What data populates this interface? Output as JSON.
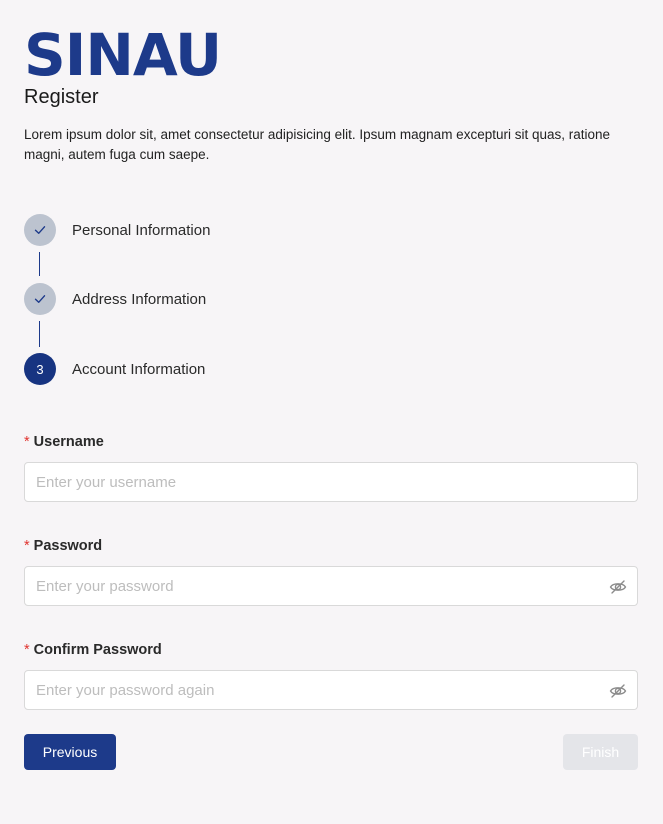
{
  "brand": {
    "logo_text": "SINAU"
  },
  "header": {
    "title": "Register",
    "description": "Lorem ipsum dolor sit, amet consectetur adipisicing elit. Ipsum magnam excepturi sit quas, ratione magni, autem fuga cum saepe."
  },
  "steps": [
    {
      "label": "Personal Information",
      "status": "completed",
      "icon": "check-icon"
    },
    {
      "label": "Address Information",
      "status": "completed",
      "icon": "check-icon"
    },
    {
      "label": "Account Information",
      "status": "active",
      "number": "3"
    }
  ],
  "form": {
    "required_marker": "*",
    "username": {
      "label": "Username",
      "placeholder": "Enter your username",
      "value": ""
    },
    "password": {
      "label": "Password",
      "placeholder": "Enter your password",
      "value": "",
      "toggle_icon": "eye-slash-icon"
    },
    "confirm_password": {
      "label": "Confirm Password",
      "placeholder": "Enter your password again",
      "value": "",
      "toggle_icon": "eye-slash-icon"
    }
  },
  "actions": {
    "previous_label": "Previous",
    "finish_label": "Finish",
    "finish_disabled": true
  },
  "colors": {
    "brand": "#1d3a8a",
    "step_done": "#bcc3cf",
    "step_active": "#173481",
    "required": "#e0342f",
    "disabled_button": "#e4e5e9",
    "background": "#f7f5f7"
  }
}
